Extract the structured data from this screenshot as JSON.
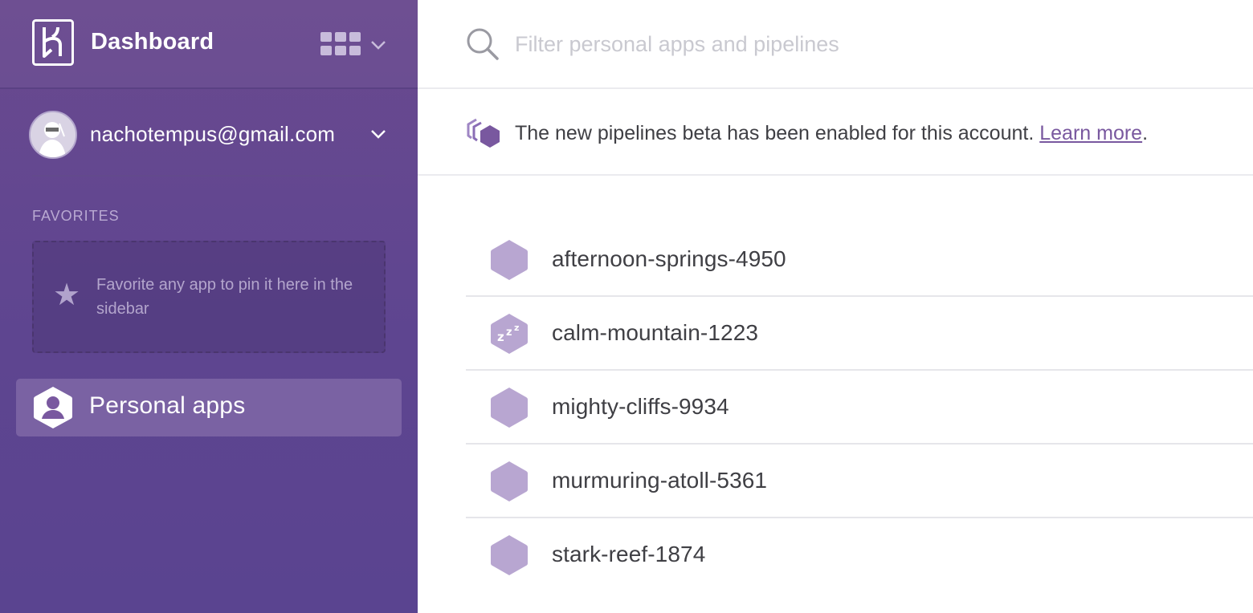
{
  "header": {
    "title": "Dashboard",
    "logo_icon": "heroku-logo-icon",
    "apps_menu_icon": "apps-grid-icon"
  },
  "account": {
    "email": "nachotempus@gmail.com",
    "avatar_icon": "ninja-avatar-icon"
  },
  "favorites": {
    "heading": "FAVORITES",
    "empty_text": "Favorite any app to pin it here in the sidebar",
    "icon": "star-icon"
  },
  "nav": {
    "personal_apps_label": "Personal apps",
    "personal_apps_icon": "user-hex-icon"
  },
  "search": {
    "placeholder": "Filter personal apps and pipelines",
    "value": ""
  },
  "banner": {
    "text": "The new pipelines beta has been enabled for this account. ",
    "link_text": "Learn more",
    "suffix": ".",
    "icon": "pipeline-icon"
  },
  "apps": [
    {
      "name": "afternoon-springs-4950",
      "status": "awake"
    },
    {
      "name": "calm-mountain-1223",
      "status": "sleeping"
    },
    {
      "name": "mighty-cliffs-9934",
      "status": "awake"
    },
    {
      "name": "murmuring-atoll-5361",
      "status": "awake"
    },
    {
      "name": "stark-reef-1874",
      "status": "awake"
    }
  ],
  "colors": {
    "sidebar_bg": "#5e4590",
    "active_item_bg": "#7a62a3",
    "app_hex": "#b8a6d1",
    "link": "#79589f"
  }
}
